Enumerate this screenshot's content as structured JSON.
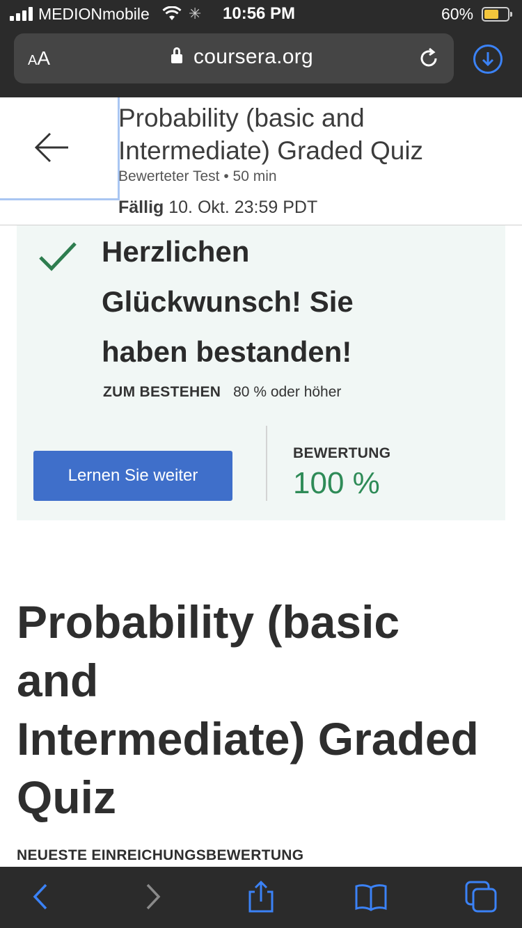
{
  "status_bar": {
    "carrier": "MEDIONmobile",
    "time": "10:56 PM",
    "battery_percent": "60%",
    "battery_level": 0.6,
    "icons": [
      "signal-icon",
      "wifi-icon",
      "activity-spinner-icon",
      "battery-icon"
    ]
  },
  "browser": {
    "text_size_label": "AA",
    "domain": "coursera.org",
    "icons": [
      "lock-icon",
      "reload-icon",
      "download-icon"
    ]
  },
  "header": {
    "title_line1": "Probability (basic and",
    "title_line2": "Intermediate) Graded Quiz",
    "meta": "Bewerteter Test • 50 min",
    "due_label": "Fällig",
    "due_value": "10. Okt. 23:59 PDT"
  },
  "result": {
    "congrats_line1": "Herzlichen",
    "congrats_line2": "Glückwunsch! Sie",
    "congrats_line3": "haben bestanden!",
    "pass_label": "ZUM BESTEHEN",
    "pass_value": "80 % oder höher",
    "continue_button": "Lernen Sie weiter",
    "grade_label": "BEWERTUNG",
    "grade_value": "100 %",
    "accent_color": "#2e8b57",
    "button_color": "#3f6fca"
  },
  "main": {
    "title_line1": "Probability (basic",
    "title_line2": "and",
    "title_line3": "Intermediate) Graded",
    "title_line4": "Quiz",
    "latest_submission_label": "NEUESTE EINREICHUNGSBEWERTUNG"
  },
  "toolbar": {
    "icons": [
      "back-icon",
      "forward-icon",
      "share-icon",
      "bookmarks-icon",
      "tabs-icon"
    ],
    "active_color": "#3b82f6",
    "disabled_color": "#8a8a8a"
  }
}
